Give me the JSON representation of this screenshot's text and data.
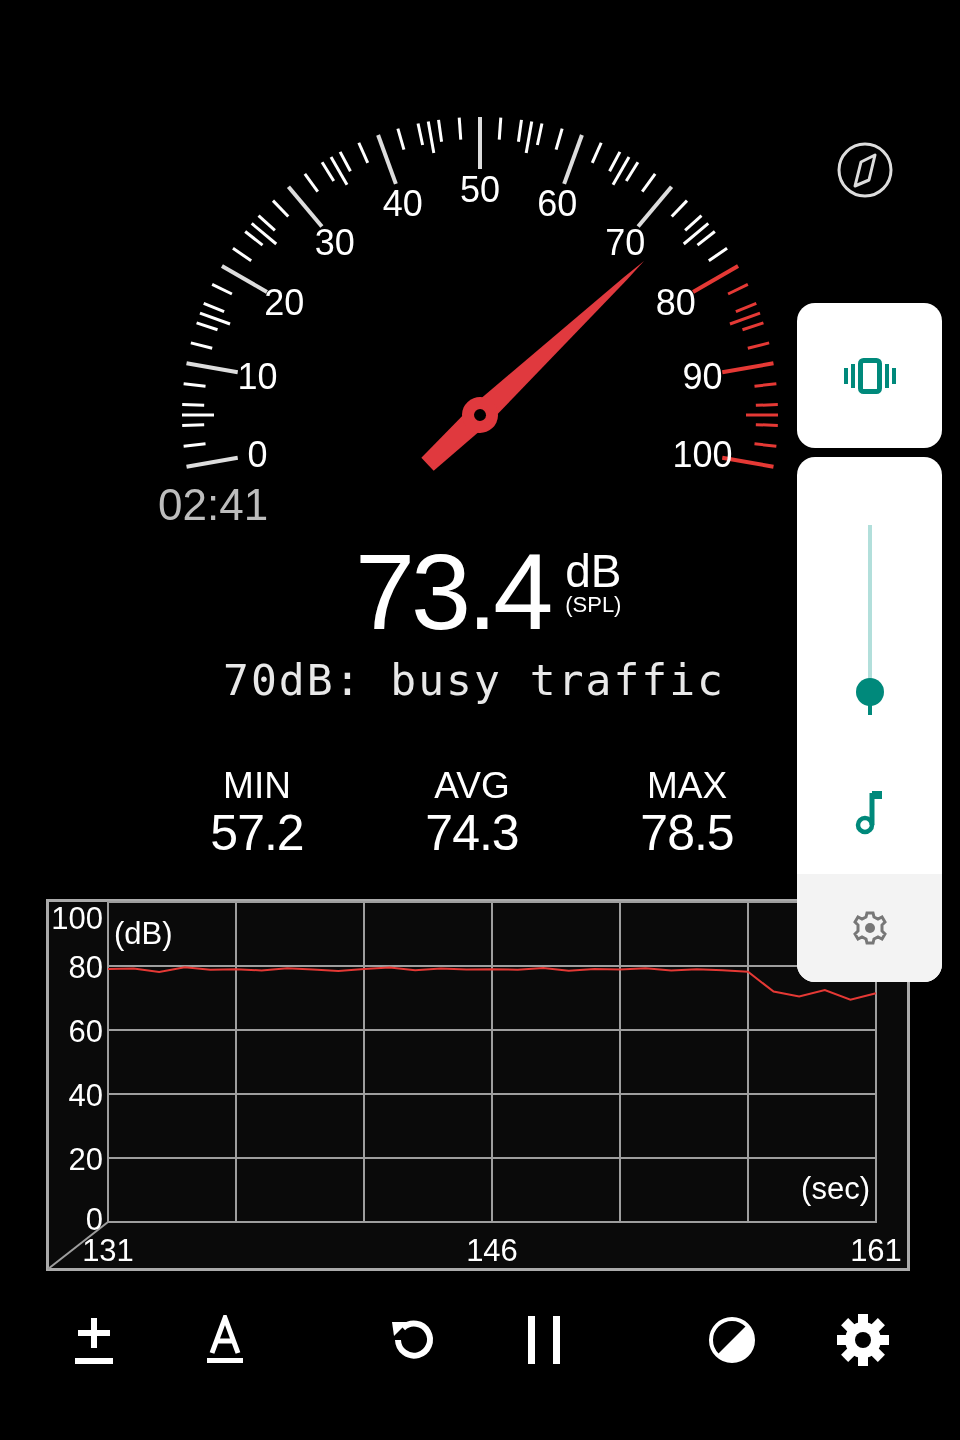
{
  "gauge": {
    "scale_labels": [
      "50",
      "40",
      "60",
      "30",
      "70",
      "20",
      "80",
      "10",
      "90",
      "0",
      "100"
    ],
    "elapsed": "02:41"
  },
  "reading": {
    "value": "73.4",
    "unit": "dB",
    "unit_note": "(SPL)",
    "description": "70dB: busy traffic"
  },
  "stats": [
    {
      "label": "MIN",
      "value": "57.2"
    },
    {
      "label": "AVG",
      "value": "74.3"
    },
    {
      "label": "MAX",
      "value": "78.5"
    }
  ],
  "chart": {
    "chart_data": {
      "type": "line",
      "grid": true,
      "xlabel": "(sec)",
      "ylabel": "(dB)",
      "xlim": [
        131,
        161
      ],
      "ylim": [
        0,
        100
      ],
      "xticks": [
        131,
        146,
        161
      ],
      "yticks": [
        0,
        20,
        40,
        60,
        80,
        100
      ],
      "x": [
        131,
        132,
        133,
        134,
        135,
        136,
        137,
        138,
        139,
        140,
        141,
        142,
        143,
        144,
        145,
        146,
        147,
        148,
        149,
        150,
        151,
        152,
        153,
        154,
        155,
        156,
        157,
        158,
        159,
        160,
        161
      ],
      "series": [
        {
          "color": "#e53935",
          "values": [
            79.1,
            79.2,
            78.1,
            79.6,
            78.8,
            79.0,
            78.6,
            79.3,
            78.9,
            78.4,
            79.1,
            79.5,
            78.7,
            79.2,
            78.9,
            79.0,
            78.8,
            79.4,
            78.5,
            79.1,
            78.9,
            79.3,
            78.6,
            79.0,
            78.7,
            78.2,
            72.0,
            70.5,
            72.5,
            69.5,
            71.5
          ]
        }
      ]
    }
  },
  "volume_panel": {
    "level": 0.12
  },
  "toolbar": [
    {
      "kind": "calibrate"
    },
    {
      "kind": "font"
    },
    {
      "kind": "reset"
    },
    {
      "kind": "pause"
    },
    {
      "kind": "theme"
    },
    {
      "kind": "settings"
    }
  ]
}
